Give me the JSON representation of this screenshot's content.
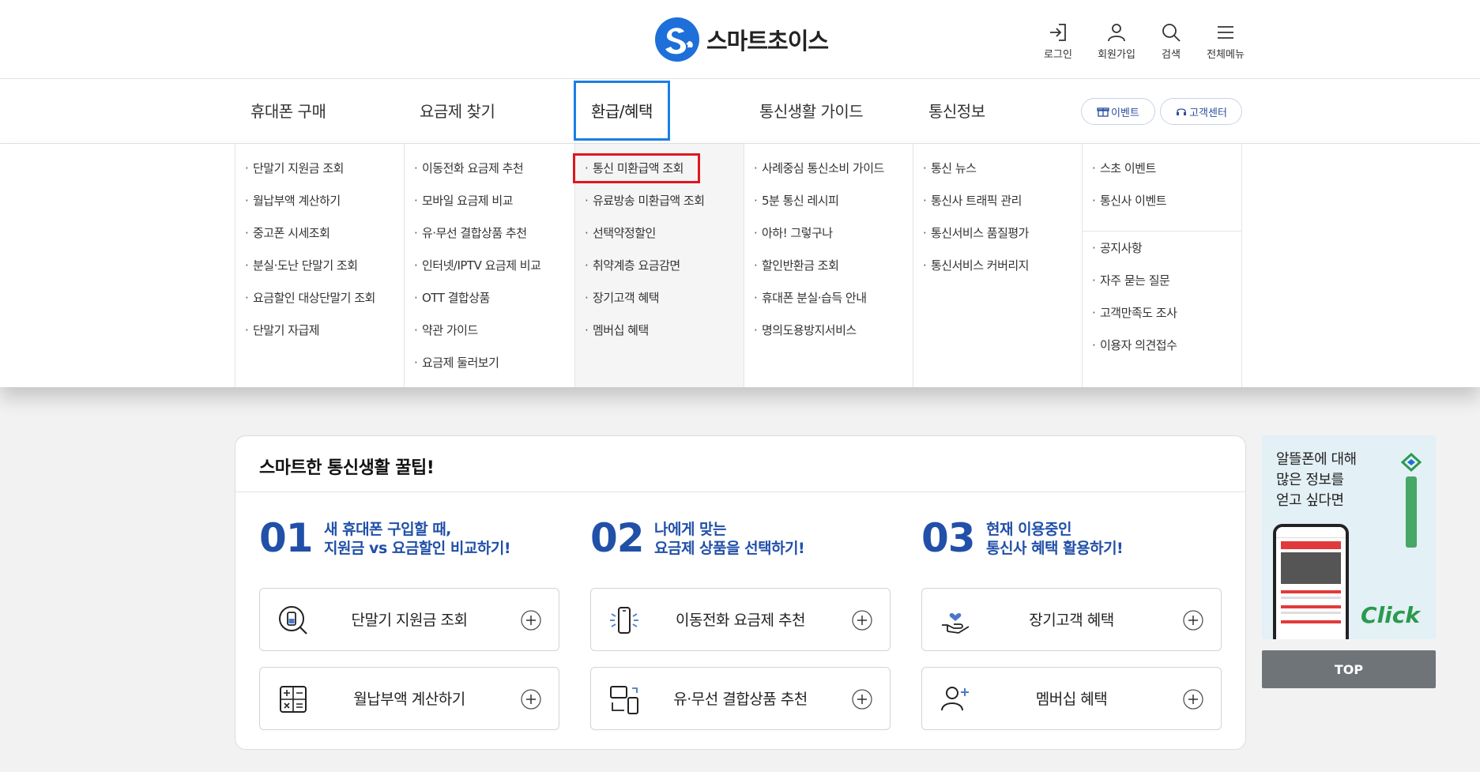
{
  "header": {
    "logo_text": "스마트초이스",
    "util": [
      {
        "label": "로그인",
        "icon": "login-icon"
      },
      {
        "label": "회원가입",
        "icon": "user-icon"
      },
      {
        "label": "검색",
        "icon": "search-icon"
      },
      {
        "label": "전체메뉴",
        "icon": "menu-icon"
      }
    ]
  },
  "gnb": {
    "items": [
      "휴대폰 구매",
      "요금제 찾기",
      "환급/혜택",
      "통신생활 가이드",
      "통신정보"
    ],
    "active": "환급/혜택",
    "pills": [
      "이벤트",
      "고객센터"
    ]
  },
  "mega": {
    "col1": [
      "단말기 지원금 조회",
      "월납부액 계산하기",
      "중고폰 시세조회",
      "분실·도난 단말기 조회",
      "요금할인 대상단말기 조회",
      "단말기 자급제"
    ],
    "col2": [
      "이동전화 요금제 추천",
      "모바일 요금제 비교",
      "유·무선 결합상품 추천",
      "인터넷/IPTV 요금제 비교",
      "OTT 결합상품",
      "약관 가이드",
      "요금제 둘러보기"
    ],
    "col3": [
      "통신 미환급액 조회",
      "유료방송 미환급액 조회",
      "선택약정할인",
      "취약계층 요금감면",
      "장기고객 혜택",
      "멤버십 혜택"
    ],
    "col4": [
      "사례중심 통신소비 가이드",
      "5분 통신 레시피",
      "아하! 그렇구나",
      "할인반환금 조회",
      "휴대폰 분실·습득 안내",
      "명의도용방지서비스"
    ],
    "col5": [
      "통신 뉴스",
      "통신사 트래픽 관리",
      "통신서비스 품질평가",
      "통신서비스 커버리지"
    ],
    "col6a": [
      "스초 이벤트",
      "통신사 이벤트"
    ],
    "col6b": [
      "공지사항",
      "자주 묻는 질문",
      "고객만족도 조사",
      "이용자 의견접수"
    ]
  },
  "tips": {
    "title": "스마트한 통신생활 꿀팁!",
    "sections": [
      {
        "num": "01",
        "line1": "새 휴대폰 구입할 때,",
        "line2": "지원금 vs 요금할인 비교하기!",
        "boxes": [
          {
            "label": "단말기 지원금 조회",
            "icon": "phone-search-icon"
          },
          {
            "label": "월납부액 계산하기",
            "icon": "calculator-icon"
          }
        ]
      },
      {
        "num": "02",
        "line1": "나에게 맞는",
        "line2": "요금제 상품을 선택하기!",
        "boxes": [
          {
            "label": "이동전화 요금제 추천",
            "icon": "mobile-signal-icon"
          },
          {
            "label": "유·무선 결합상품 추천",
            "icon": "devices-icon"
          }
        ]
      },
      {
        "num": "03",
        "line1": "현재 이용중인",
        "line2": "통신사 혜택 활용하기!",
        "boxes": [
          {
            "label": "장기고객 혜택",
            "icon": "heart-hand-icon"
          },
          {
            "label": "멤버십 혜택",
            "icon": "user-plus-icon"
          }
        ]
      }
    ]
  },
  "banner": {
    "line1": "알뜰폰에 대해",
    "line2": "많은 정보를",
    "line3": "얻고 싶다면",
    "click": "Click"
  },
  "top_button": "TOP",
  "colors": {
    "brand_blue": "#2150a8",
    "active_border": "#1a7fe6",
    "highlight_red": "#e0161e"
  }
}
